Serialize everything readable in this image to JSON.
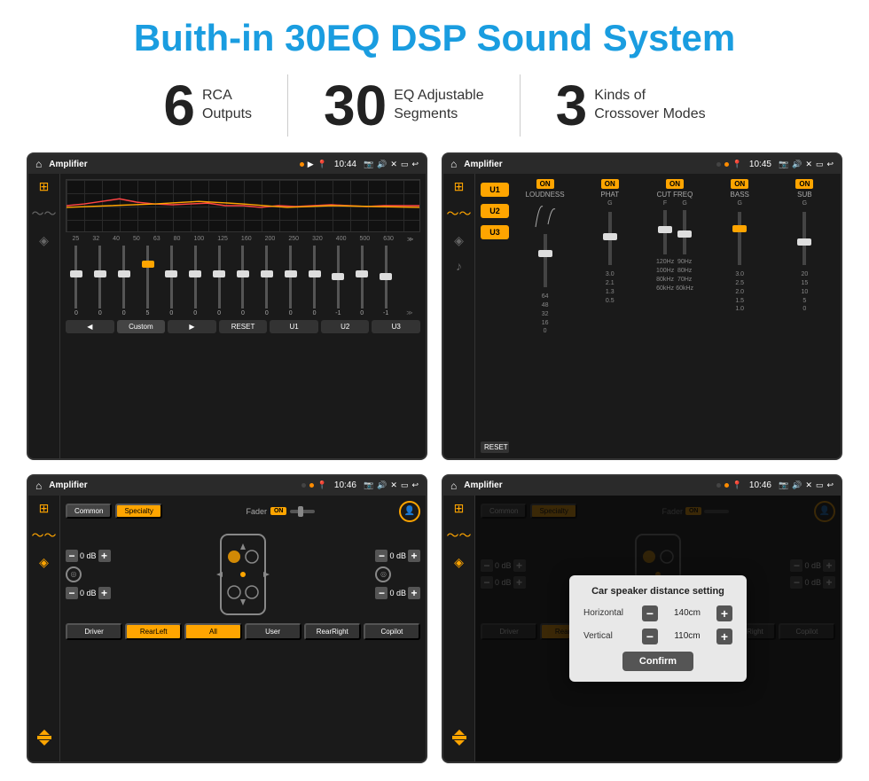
{
  "page": {
    "main_title": "Buith-in 30EQ DSP Sound System",
    "stats": [
      {
        "number": "6",
        "label_line1": "RCA",
        "label_line2": "Outputs"
      },
      {
        "number": "30",
        "label_line1": "EQ Adjustable",
        "label_line2": "Segments"
      },
      {
        "number": "3",
        "label_line1": "Kinds of",
        "label_line2": "Crossover Modes"
      }
    ]
  },
  "screen1": {
    "title": "Amplifier",
    "time": "10:44",
    "eq_freqs": [
      "25",
      "32",
      "40",
      "50",
      "63",
      "80",
      "100",
      "125",
      "160",
      "200",
      "250",
      "320",
      "400",
      "500",
      "630"
    ],
    "eq_values": [
      "0",
      "0",
      "0",
      "5",
      "0",
      "0",
      "0",
      "0",
      "0",
      "0",
      "0",
      "-1",
      "0",
      "-1"
    ],
    "preset_label": "Custom",
    "buttons": [
      "◀",
      "Custom",
      "▶",
      "RESET",
      "U1",
      "U2",
      "U3"
    ]
  },
  "screen2": {
    "title": "Amplifier",
    "time": "10:45",
    "presets": [
      "U1",
      "U2",
      "U3"
    ],
    "controls": [
      "LOUDNESS",
      "PHAT",
      "CUT FREQ",
      "BASS",
      "SUB"
    ],
    "on_labels": [
      "ON",
      "ON",
      "ON",
      "ON",
      "ON"
    ],
    "reset_label": "RESET"
  },
  "screen3": {
    "title": "Amplifier",
    "time": "10:46",
    "tabs": [
      "Common",
      "Specialty"
    ],
    "fader_label": "Fader",
    "on_label": "ON",
    "db_values": [
      "0 dB",
      "0 dB",
      "0 dB",
      "0 dB"
    ],
    "buttons": [
      "Driver",
      "RearLeft",
      "All",
      "User",
      "RearRight",
      "Copilot"
    ]
  },
  "screen4": {
    "title": "Amplifier",
    "time": "10:46",
    "tabs": [
      "Common",
      "Specialty"
    ],
    "dialog": {
      "title": "Car speaker distance setting",
      "horizontal_label": "Horizontal",
      "horizontal_value": "140cm",
      "vertical_label": "Vertical",
      "vertical_value": "110cm",
      "confirm_label": "Confirm"
    },
    "db_values": [
      "0 dB",
      "0 dB"
    ],
    "buttons": [
      "Driver",
      "RearLeft",
      "All",
      "User",
      "RearRight",
      "Copilot"
    ]
  },
  "icons": {
    "home": "⌂",
    "back": "↩",
    "pin": "📍",
    "camera": "📷",
    "volume": "🔊",
    "settings": "⚙",
    "eq_icon": "≋",
    "wave_icon": "〜",
    "speaker_icon": "◈",
    "sliders_icon": "⊞",
    "person_icon": "👤"
  }
}
